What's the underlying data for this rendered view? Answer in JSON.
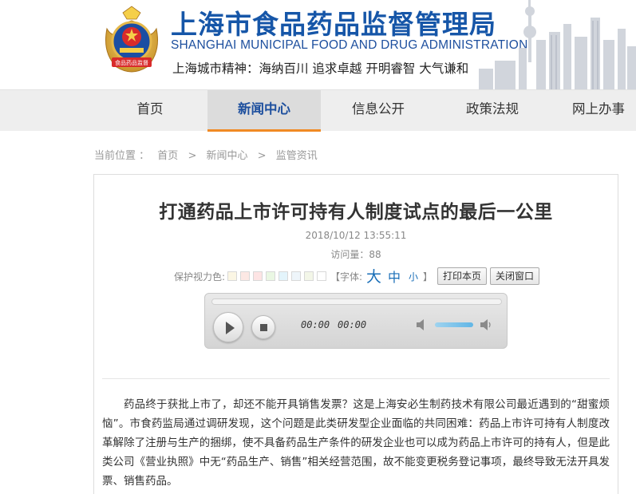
{
  "header": {
    "title_cn": "上海市食品药品监督管理局",
    "title_en": "SHANGHAI MUNICIPAL FOOD AND DRUG ADMINISTRATION",
    "spirit": "上海城市精神：海纳百川  追求卓越  开明睿智  大气谦和",
    "emblem_text": "食品药品监督",
    "colors": {
      "brand_blue": "#1656a8",
      "accent_orange": "#f08a24"
    }
  },
  "nav": {
    "items": [
      {
        "label": "首页"
      },
      {
        "label": "新闻中心",
        "active": true
      },
      {
        "label": "信息公开"
      },
      {
        "label": "政策法规"
      },
      {
        "label": "网上办事"
      }
    ]
  },
  "breadcrumb": {
    "prefix": "当前位置 ：",
    "items": [
      "首页",
      "新闻中心",
      "监管资讯"
    ],
    "separator": ">"
  },
  "article": {
    "title": "打通药品上市许可持有人制度试点的最后一公里",
    "date": "2018/10/12 13:55:11",
    "views": "访问量：88",
    "toolbar": {
      "eye_color_label": "保护视力色:",
      "swatches": [
        "#fbf6e4",
        "#fce8e4",
        "#fde4e4",
        "#eaf7e3",
        "#e3f4fb",
        "#eef5fa",
        "#f3f6e8",
        "#ffffff"
      ],
      "font_label": "【字体:",
      "font_big": "大",
      "font_mid": "中",
      "font_small": "小",
      "font_close": "】",
      "print_label": "打印本页",
      "close_label": "关闭窗口"
    },
    "player": {
      "current_time": "00:00",
      "total_time": "00:00",
      "progress": 0,
      "volume": 0.8
    },
    "body": "药品终于获批上市了，却还不能开具销售发票？这是上海安必生制药技术有限公司最近遇到的“甜蜜烦恼”。市食药监局通过调研发现，这个问题是此类研发型企业面临的共同困难：药品上市许可持有人制度改革解除了注册与生产的捆绑，使不具备药品生产条件的研发企业也可以成为药品上市许可的持有人，但是此类公司《营业执照》中无“药品生产、销售”相关经营范围，故不能变更税务登记事项，最终导致无法开具发票、销售药品。"
  }
}
